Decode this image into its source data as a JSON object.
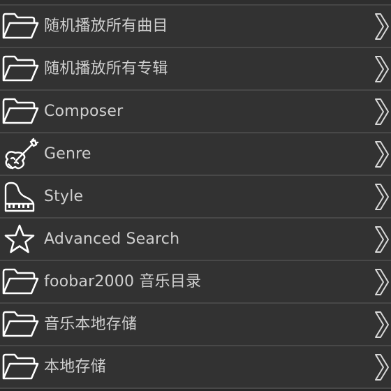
{
  "list": {
    "items": [
      {
        "label": "随机播放所有曲目",
        "icon": "folder-icon",
        "name": "shuffle-all-tracks"
      },
      {
        "label": "随机播放所有专辑",
        "icon": "folder-icon",
        "name": "shuffle-all-albums"
      },
      {
        "label": "Composer",
        "icon": "folder-icon",
        "name": "composer"
      },
      {
        "label": "Genre",
        "icon": "violin-icon",
        "name": "genre"
      },
      {
        "label": "Style",
        "icon": "piano-icon",
        "name": "style"
      },
      {
        "label": "Advanced Search",
        "icon": "star-icon",
        "name": "advanced-search"
      },
      {
        "label": "foobar2000 音乐目录",
        "icon": "folder-icon",
        "name": "foobar2000-music-library"
      },
      {
        "label": "音乐本地存储",
        "icon": "folder-icon",
        "name": "music-local-storage"
      },
      {
        "label": "本地存储",
        "icon": "folder-icon",
        "name": "local-storage"
      }
    ],
    "chevron_icon": "chevron-right-icon"
  },
  "colors": {
    "background": "#272727",
    "row": "#323232",
    "divider": "#484848",
    "text": "#cfcfcf",
    "icon": "#ffffff",
    "chevron": "#d8d8d8"
  }
}
